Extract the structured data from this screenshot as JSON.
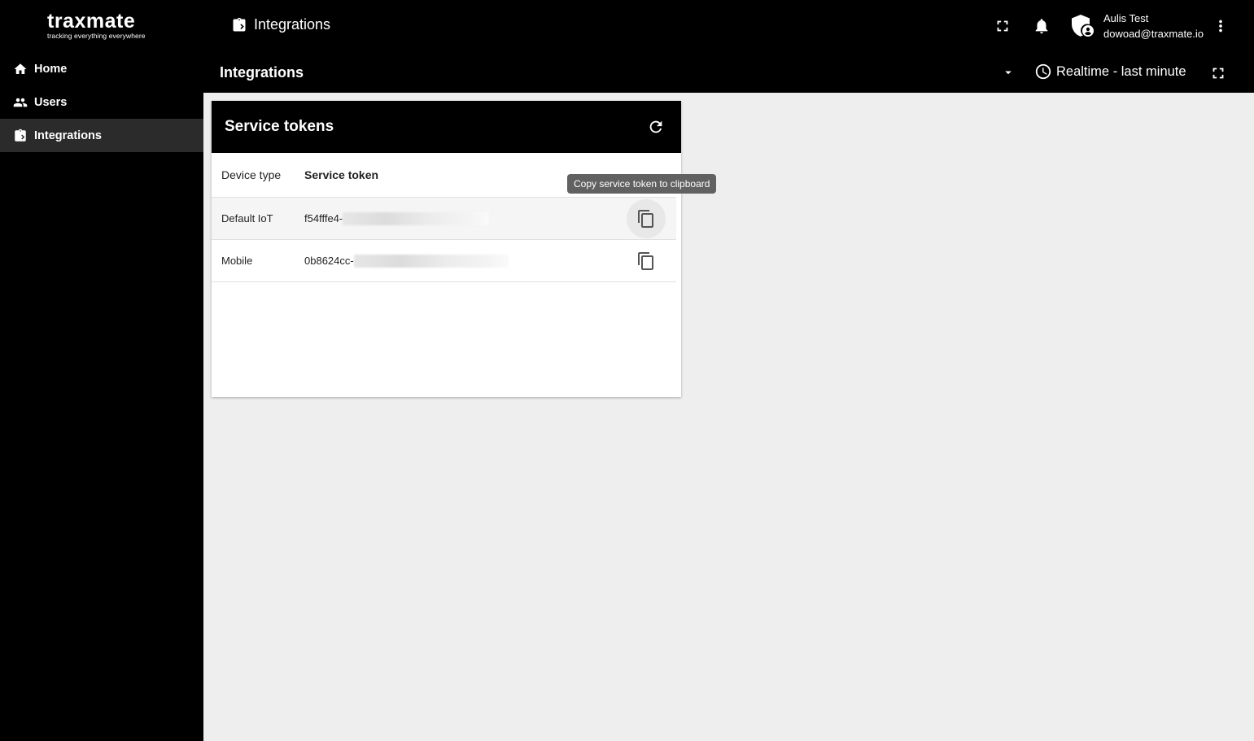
{
  "app": {
    "logo_name": "traxmate",
    "logo_tagline": "tracking everything everywhere"
  },
  "sidebar": {
    "items": [
      {
        "label": "Home",
        "icon": "home-icon"
      },
      {
        "label": "Users",
        "icon": "users-icon"
      },
      {
        "label": "Integrations",
        "icon": "integrations-icon",
        "active": true
      }
    ]
  },
  "header": {
    "breadcrumb": "Integrations",
    "user_name": "Aulis Test",
    "user_email": "dowoad@traxmate.io"
  },
  "subheader": {
    "title": "Integrations",
    "time_range": "Realtime - last minute"
  },
  "card": {
    "title": "Service tokens",
    "columns": [
      "Device type",
      "Service token"
    ],
    "rows": [
      {
        "device_type": "Default IoT",
        "token_prefix": "f54fffe4-"
      },
      {
        "device_type": "Mobile",
        "token_prefix": "0b8624cc-"
      }
    ],
    "tooltip": "Copy service token to clipboard"
  },
  "colors": {
    "background": "#000000",
    "content_bg": "#eeeeee",
    "card_bg": "#ffffff",
    "tooltip_bg": "#616161"
  }
}
